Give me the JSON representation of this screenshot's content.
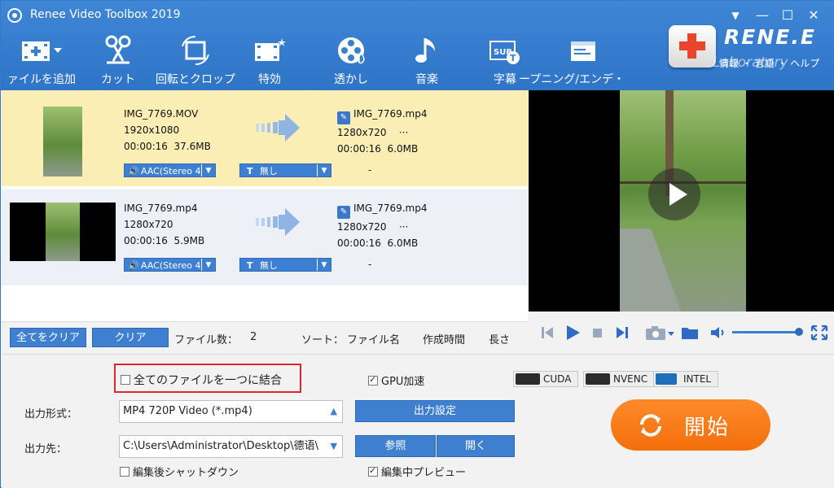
{
  "window": {
    "title": "Renee Video Toolbox 2019"
  },
  "toolbar": {
    "items": [
      {
        "label": "ァイルを追加",
        "icon": "add-film-icon"
      },
      {
        "label": "カット",
        "icon": "scissors-icon"
      },
      {
        "label": "回転とクロップ",
        "icon": "crop-rotate-icon"
      },
      {
        "label": "特効",
        "icon": "effects-film-icon"
      },
      {
        "label": "透かし",
        "icon": "watermark-reel-icon"
      },
      {
        "label": "音楽",
        "icon": "music-note-icon"
      },
      {
        "label": "字幕",
        "icon": "subtitle-icon"
      },
      {
        "label": "ープニング/エンデ・",
        "icon": "opening-ending-icon"
      }
    ],
    "right_links": "情報 ・ 言語  ・ ヘルプ"
  },
  "brand": {
    "name": "RENE.E",
    "sub": "Laboratory"
  },
  "files": [
    {
      "source_name": "IMG_7769.MOV",
      "source_res": "1920x1080",
      "source_dur_size": "00:00:16  37.6MB",
      "target_name": "IMG_7769.mp4",
      "target_res": "1280x720",
      "target_more": "···",
      "target_dur_size": "00:00:16  6.0MB",
      "audio": "AAC(Stereo 4",
      "subtitle": "無し",
      "dash": "-"
    },
    {
      "source_name": "IMG_7769.mp4",
      "source_res": "1280x720",
      "source_dur_size": "00:00:16  5.9MB",
      "target_name": "IMG_7769.mp4",
      "target_res": "1280x720",
      "target_more": "···",
      "target_dur_size": "00:00:16  6.0MB",
      "audio": "AAC(Stereo 4",
      "subtitle": "無し",
      "dash": "-"
    }
  ],
  "listbar": {
    "clear_all": "全てをクリア",
    "clear": "クリア",
    "file_count_label": "ファイル数：",
    "file_count": "2",
    "sort_label": "ソート：",
    "sort_name": "ファイル名",
    "sort_time": "作成時間",
    "sort_length": "長さ"
  },
  "settings": {
    "merge_label": "全てのファイルを一つに結合",
    "merge_checked": false,
    "gpu_label": "GPU加速",
    "gpu_checked": true,
    "badges": [
      "CUDA",
      "NVENC",
      "INTEL"
    ],
    "format_label": "出力形式：",
    "format_value": "MP4 720P Video (*.mp4)",
    "output_settings": "出力設定",
    "dest_label": "出力先：",
    "dest_value": "C:\\Users\\Administrator\\Desktop\\德语\\",
    "browse": "参照",
    "open": "開く",
    "shutdown_label": "編集後シャットダウン",
    "shutdown_checked": false,
    "preview_label": "編集中プレビュー",
    "preview_checked": true,
    "start": "開始"
  },
  "player": {
    "volume_level": 0.9
  }
}
